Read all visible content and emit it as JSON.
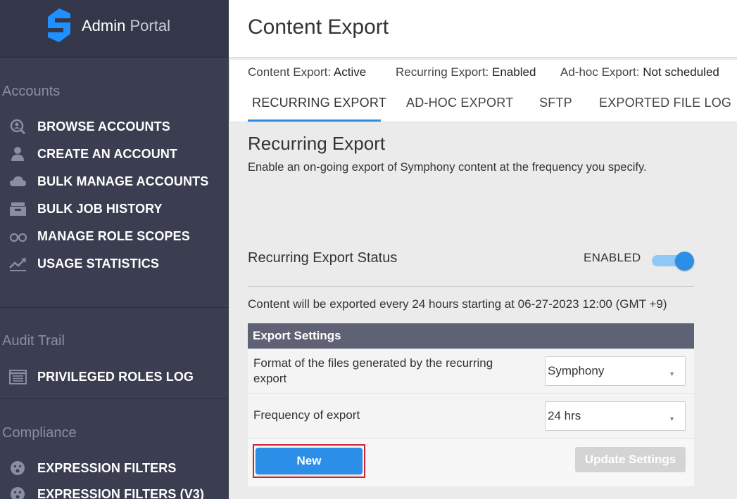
{
  "brand": {
    "name": "Admin",
    "suffix": "Portal"
  },
  "sidebar": {
    "sections": [
      {
        "title": "Accounts"
      },
      {
        "title": "Audit Trail"
      },
      {
        "title": "Compliance"
      }
    ],
    "items": [
      {
        "label": "BROWSE ACCOUNTS",
        "icon": "search-user-icon"
      },
      {
        "label": "CREATE AN ACCOUNT",
        "icon": "user-icon"
      },
      {
        "label": "BULK MANAGE ACCOUNTS",
        "icon": "cloud-icon"
      },
      {
        "label": "BULK JOB HISTORY",
        "icon": "archive-icon"
      },
      {
        "label": "MANAGE ROLE SCOPES",
        "icon": "binoculars-icon"
      },
      {
        "label": "USAGE STATISTICS",
        "icon": "trend-chart-icon"
      },
      {
        "label": "PRIVILEGED ROLES LOG",
        "icon": "calendar-list-icon"
      },
      {
        "label": "EXPRESSION FILTERS",
        "icon": "filter-face-icon"
      },
      {
        "label": "EXPRESSION FILTERS (V3)",
        "icon": "filter-face-icon"
      }
    ]
  },
  "header": {
    "title": "Content Export"
  },
  "status": [
    {
      "key": "Content Export:",
      "value": "Active"
    },
    {
      "key": "Recurring Export:",
      "value": "Enabled"
    },
    {
      "key": "Ad-hoc Export:",
      "value": "Not scheduled"
    }
  ],
  "tabs": [
    {
      "label": "RECURRING EXPORT",
      "active": true
    },
    {
      "label": "AD-HOC EXPORT",
      "active": false
    },
    {
      "label": "SFTP",
      "active": false
    },
    {
      "label": "EXPORTED FILE LOG",
      "active": false
    }
  ],
  "recurring": {
    "title": "Recurring Export",
    "description": "Enable an on-going export of Symphony content at the frequency you specify.",
    "status_label": "Recurring Export Status",
    "status_value": "ENABLED",
    "schedule_text": "Content will be exported every 24 hours starting at 06-27-2023 12:00 (GMT +9)"
  },
  "settings": {
    "title": "Export Settings",
    "format_label": "Format of the files generated by the recurring export",
    "format_value": "Symphony",
    "frequency_label": "Frequency of export",
    "frequency_value": "24 hrs",
    "new_label": "New",
    "update_label": "Update Settings"
  },
  "colors": {
    "sidebar_bg": "#3b3e50",
    "accent": "#2b8fe8",
    "highlight_outline": "#d0232a",
    "panel_header": "#5f6275"
  }
}
